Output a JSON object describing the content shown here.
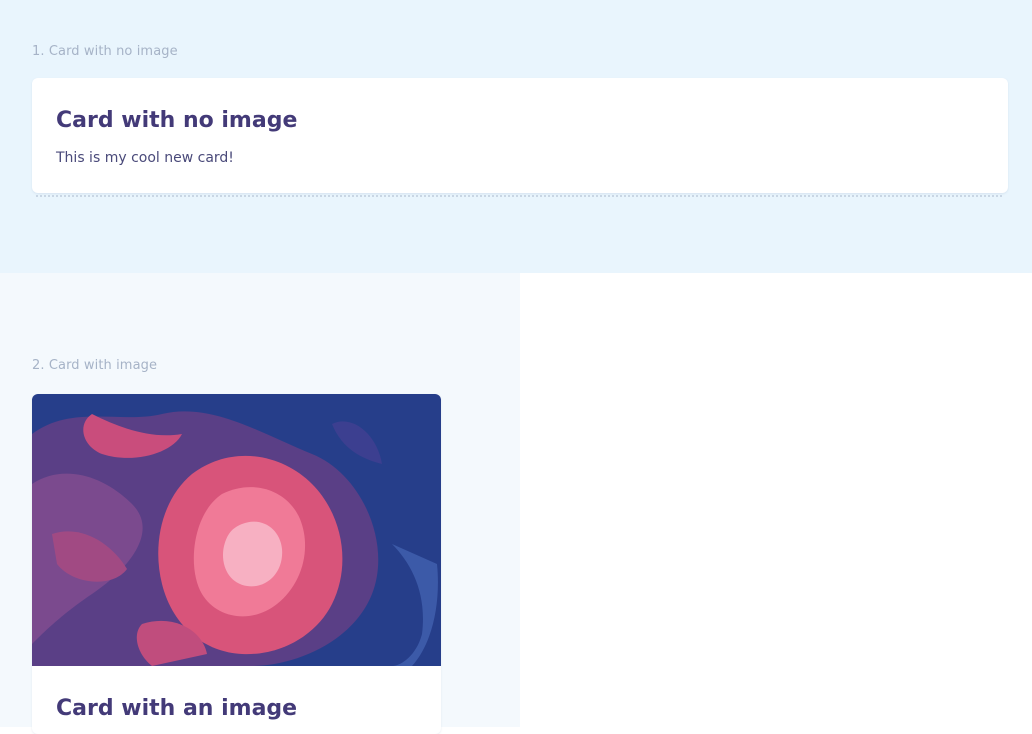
{
  "sections": [
    {
      "label": "1. Card with no image",
      "card": {
        "title": "Card with no image",
        "text": "This is my cool new card!"
      }
    },
    {
      "label": "2. Card with image",
      "card": {
        "title": "Card with an image"
      }
    }
  ],
  "colors": {
    "title": "#433a78",
    "label": "#a6b3c7",
    "section_bg": "#e9f5fd",
    "image_blue": "#253f8c",
    "image_pink": "#e3577a"
  }
}
